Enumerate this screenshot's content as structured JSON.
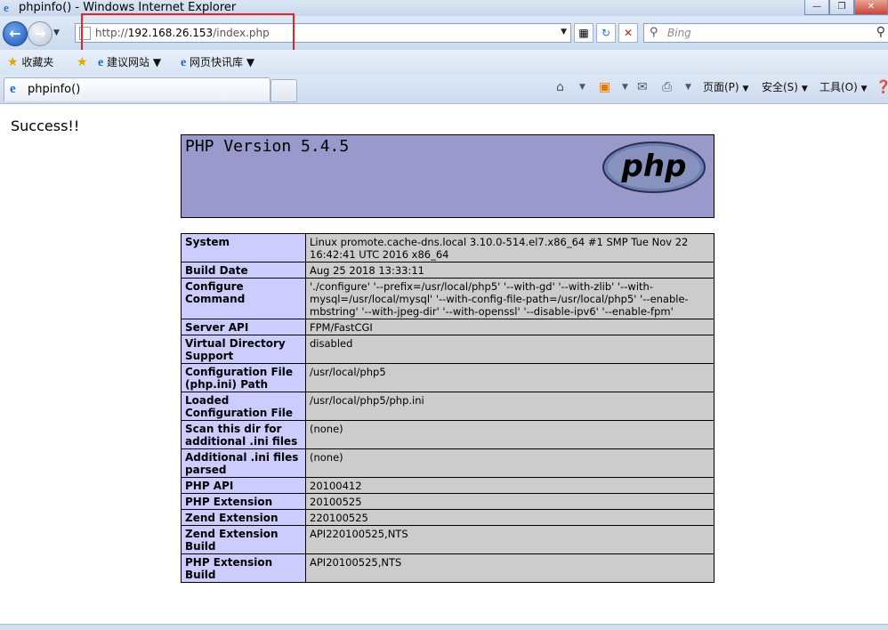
{
  "window": {
    "title": "phpinfo() - Windows Internet Explorer",
    "min_label": "—",
    "max_label": "❐",
    "close_label": "✕"
  },
  "address_bar": {
    "url_prefix": "http://",
    "url_host": "192.168.26.153",
    "url_path": "/index.php",
    "search_placeholder": "Bing"
  },
  "favorites_bar": {
    "favorites_label": "收藏夹",
    "suggested_sites_label": "建议网站",
    "web_slice_gallery_label": "网页快讯库"
  },
  "tabs": {
    "active_tab_label": "phpinfo()"
  },
  "command_bar": {
    "page_label": "页面(P)",
    "safety_label": "安全(S)",
    "tools_label": "工具(O)"
  },
  "page": {
    "success_text": "Success!!",
    "php_version": "PHP Version 5.4.5",
    "logo_text": "php",
    "rows": [
      {
        "key": "System",
        "value": "Linux promote.cache-dns.local 3.10.0-514.el7.x86_64 #1 SMP Tue Nov 22 16:42:41 UTC 2016 x86_64"
      },
      {
        "key": "Build Date",
        "value": "Aug 25 2018 13:33:11"
      },
      {
        "key": "Configure Command",
        "value": "'./configure' '--prefix=/usr/local/php5' '--with-gd' '--with-zlib' '--with-mysql=/usr/local/mysql' '--with-config-file-path=/usr/local/php5' '--enable-mbstring' '--with-jpeg-dir' '--with-openssl' '--disable-ipv6' '--enable-fpm'"
      },
      {
        "key": "Server API",
        "value": "FPM/FastCGI"
      },
      {
        "key": "Virtual Directory Support",
        "value": "disabled"
      },
      {
        "key": "Configuration File (php.ini) Path",
        "value": "/usr/local/php5"
      },
      {
        "key": "Loaded Configuration File",
        "value": "/usr/local/php5/php.ini"
      },
      {
        "key": "Scan this dir for additional .ini files",
        "value": "(none)"
      },
      {
        "key": "Additional .ini files parsed",
        "value": "(none)"
      },
      {
        "key": "PHP API",
        "value": "20100412"
      },
      {
        "key": "PHP Extension",
        "value": "20100525"
      },
      {
        "key": "Zend Extension",
        "value": "220100525"
      },
      {
        "key": "Zend Extension Build",
        "value": "API220100525,NTS"
      },
      {
        "key": "PHP Extension Build",
        "value": "API20100525,NTS"
      }
    ]
  },
  "colors": {
    "php_header_bg": "#9999cc",
    "key_cell_bg": "#ccccff",
    "value_cell_bg": "#cccccc",
    "highlight_box": "#e0262a"
  }
}
